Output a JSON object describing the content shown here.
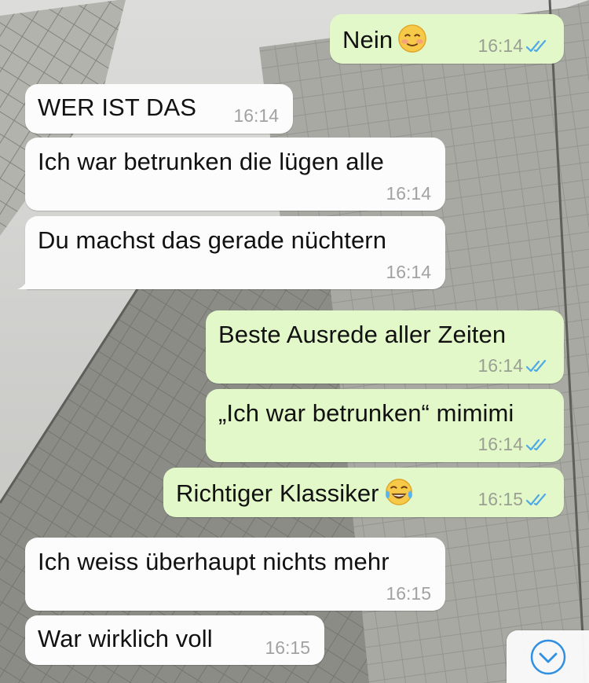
{
  "messages": [
    {
      "direction": "out",
      "text": "Nein",
      "emoji": "smiling-blush",
      "time": "16:14",
      "read": true
    },
    {
      "direction": "in",
      "text": "WER IST DAS",
      "time": "16:14"
    },
    {
      "direction": "in",
      "text": "Ich war betrunken die lügen alle",
      "time": "16:14"
    },
    {
      "direction": "in",
      "text": "Du machst das gerade nüchtern",
      "time": "16:14"
    },
    {
      "direction": "out",
      "text": "Beste Ausrede aller Zeiten",
      "time": "16:14",
      "read": true
    },
    {
      "direction": "out",
      "text": "„Ich war betrunken“ mimimi",
      "time": "16:14",
      "read": true
    },
    {
      "direction": "out",
      "text": "Richtiger Klassiker",
      "emoji": "tears-of-joy",
      "time": "16:15",
      "read": true
    },
    {
      "direction": "in",
      "text": "Ich weiss überhaupt nichts mehr",
      "time": "16:15"
    },
    {
      "direction": "in",
      "text": "War wirklich voll",
      "time": "16:15"
    }
  ],
  "scroll_button": {
    "icon": "chevron-down-circle-icon"
  },
  "colors": {
    "outgoing_bubble": "#e2f8c9",
    "incoming_bubble": "#fcfcfc",
    "read_ticks": "#4fa9e6",
    "accent": "#2f8fe0"
  }
}
